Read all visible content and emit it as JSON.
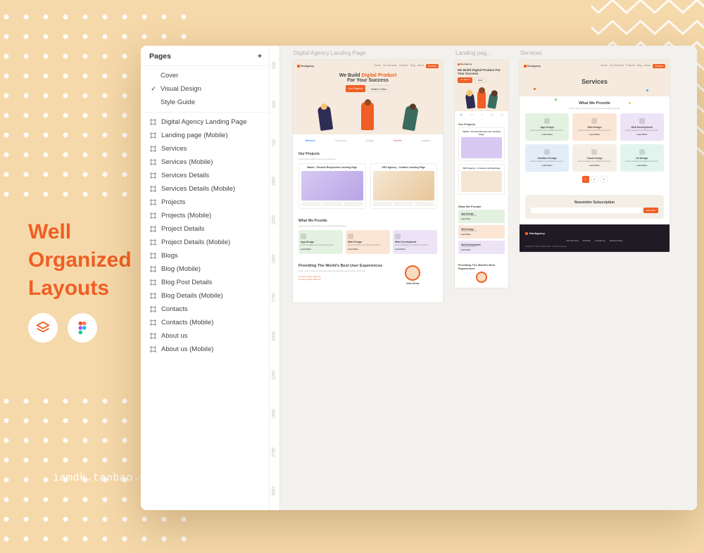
{
  "hero_title_lines": [
    "Well",
    "Organized",
    "Layouts"
  ],
  "watermark": "iamdk.taobao.com",
  "panel": {
    "header": "Pages",
    "pages": [
      {
        "label": "Cover",
        "active": false
      },
      {
        "label": "Visual Design",
        "active": true
      },
      {
        "label": "Style Guide",
        "active": false
      }
    ],
    "frames": [
      "Digital Agency Landing Page",
      "Landing page (Mobile)",
      "Services",
      "Services (Mobile)",
      "Services Details",
      "Services Details (Mobile)",
      "Projects",
      "Projects (Mobile)",
      "Project Details",
      "Project Details (Mobile)",
      "Blogs",
      "Blog (Mobile)",
      "Blog Post Details",
      "Blog Details (Mobile)",
      "Contacts",
      "Contacts (Mobile)",
      "About us",
      "About us (Mobile)"
    ]
  },
  "ruler_marks": [
    "250",
    "500",
    "750",
    "1000",
    "1250",
    "1500",
    "1750",
    "2000",
    "2250",
    "2500",
    "2750",
    "3000"
  ],
  "artboards": {
    "a1": {
      "label": "Digital Agency Landing Page",
      "brand": "DevAgency",
      "nav": [
        "Home",
        "Our Services",
        "Projects",
        "Blog",
        "About"
      ],
      "nav_cta": "Contact",
      "headline_pre": "We Build ",
      "headline_accent": "Digital Product",
      "headline_post": "For Your Success",
      "cta_primary": "Get Started",
      "cta_secondary": "Watch Video",
      "brands": [
        "Bēhance",
        "Coca-Cola",
        "Google",
        "dribbble",
        "amazon"
      ],
      "projects_title": "Our Projects",
      "proj1": "Watch - Product Responsive Landing Page",
      "proj2": "SEO Agency - Creative Landing Page",
      "provide_title": "What We Provide",
      "tiles": [
        {
          "t": "App Design",
          "c": "c-green"
        },
        {
          "t": "Web Design",
          "c": "c-orange"
        },
        {
          "t": "Web Development",
          "c": "c-purple"
        }
      ],
      "tile_link": "Learn More",
      "ux_title": "Providing The World's Best User Experiences",
      "ux_name": "John Snow"
    },
    "a2": {
      "label": "Landing pag...",
      "brand": "DevAgency",
      "headline": "We Build Digital Product For Your Success",
      "projects_title": "Our Projects",
      "proj1": "Watch - Product Responsive Landing Page",
      "proj2": "SEO Agency - Creative Landing Page",
      "provide_title": "What We Provide",
      "tiles": [
        {
          "t": "App Design",
          "c": "c-green"
        },
        {
          "t": "Web Design",
          "c": "c-orange"
        },
        {
          "t": "Web Development",
          "c": "c-purple"
        }
      ],
      "ux_title": "Providing The World's Best Experiences"
    },
    "a3": {
      "label": "Services",
      "brand": "DevAgency",
      "nav": [
        "Home",
        "Our Services",
        "Projects",
        "Blog",
        "About"
      ],
      "nav_cta": "Contact",
      "headline": "Services",
      "provide_title": "What We Provide",
      "tiles": [
        {
          "t": "App Design",
          "c": "c-green"
        },
        {
          "t": "Web Design",
          "c": "c-orange"
        },
        {
          "t": "Web Development",
          "c": "c-purple"
        },
        {
          "t": "Interface Design",
          "c": "c-blue"
        },
        {
          "t": "Cloud Design",
          "c": "c-cream"
        },
        {
          "t": "UX Design",
          "c": "c-mint"
        }
      ],
      "tile_link": "Learn More",
      "pager": [
        "1",
        "2",
        "3"
      ],
      "newsletter_title": "Newsletter Subscription",
      "newsletter_btn": "Subscribe",
      "footer_links": [
        "Our Services",
        "Portfolio",
        "Contact Us",
        "Privacy Policy"
      ],
      "copyright": "Copyright © Martin Tobias 2021. All rights reserved."
    }
  }
}
